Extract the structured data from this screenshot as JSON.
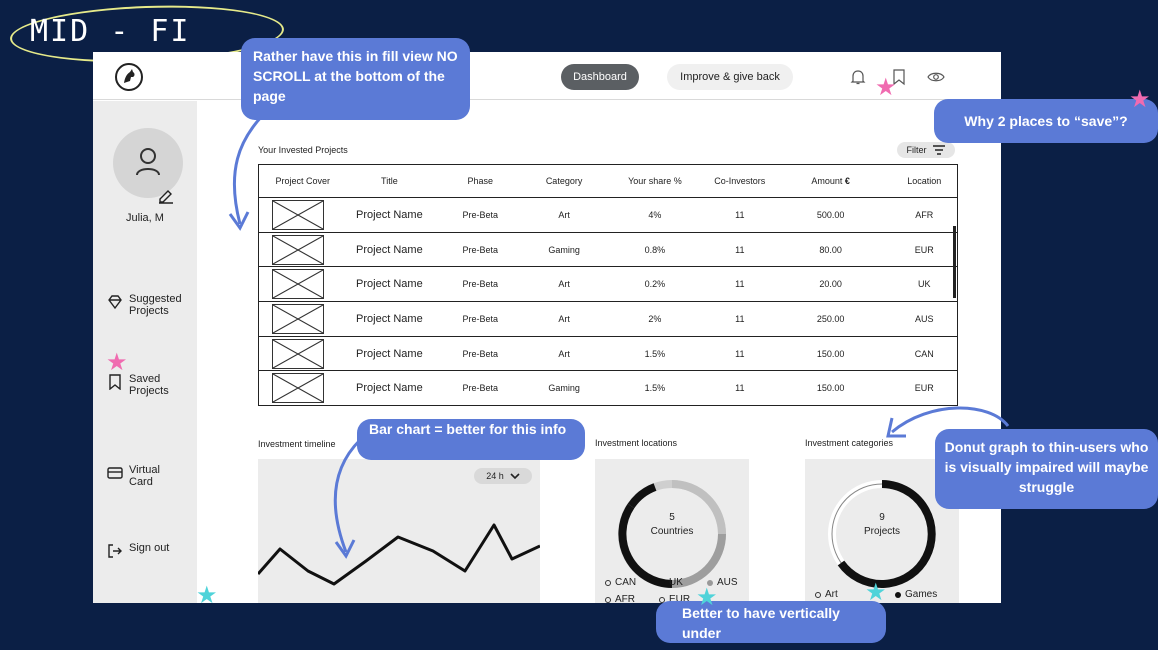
{
  "mockup_label": "MID - FI",
  "header": {
    "dashboard_label": "Dashboard",
    "improve_label": "Improve & give back"
  },
  "sidebar": {
    "user_name": "Julia, M",
    "items": [
      {
        "line1": "Suggested",
        "line2": "Projects",
        "icon": "diamond-icon"
      },
      {
        "line1": "Saved",
        "line2": "Projects",
        "icon": "bookmark-icon"
      },
      {
        "line1": "Virtual",
        "line2": "Card",
        "icon": "card-icon"
      },
      {
        "line1": "Sign out",
        "line2": "",
        "icon": "sign-out-icon"
      }
    ]
  },
  "projects": {
    "section_title": "Your Invested Projects",
    "filter_label": "Filter",
    "columns": [
      "Project Cover",
      "Title",
      "Phase",
      "Category",
      "Your share %",
      "Co-Investors",
      "Amount",
      "Location"
    ],
    "rows": [
      {
        "title": "Project Name",
        "phase": "Pre-Beta",
        "category": "Art",
        "share": "4%",
        "co": "11",
        "amount": "500.00",
        "location": "AFR"
      },
      {
        "title": "Project Name",
        "phase": "Pre-Beta",
        "category": "Gaming",
        "share": "0.8%",
        "co": "11",
        "amount": "80.00",
        "location": "EUR"
      },
      {
        "title": "Project Name",
        "phase": "Pre-Beta",
        "category": "Art",
        "share": "0.2%",
        "co": "11",
        "amount": "20.00",
        "location": "UK"
      },
      {
        "title": "Project Name",
        "phase": "Pre-Beta",
        "category": "Art",
        "share": "2%",
        "co": "11",
        "amount": "250.00",
        "location": "AUS"
      },
      {
        "title": "Project Name",
        "phase": "Pre-Beta",
        "category": "Art",
        "share": "1.5%",
        "co": "11",
        "amount": "150.00",
        "location": "CAN"
      },
      {
        "title": "Project Name",
        "phase": "Pre-Beta",
        "category": "Gaming",
        "share": "1.5%",
        "co": "11",
        "amount": "150.00",
        "location": "EUR"
      }
    ]
  },
  "timeline": {
    "title": "Investment timeline",
    "range_label": "24 h"
  },
  "locations": {
    "title": "Investment locations",
    "count": "5",
    "unit": "Countries",
    "legend": [
      "CAN",
      "UK",
      "AUS",
      "AFR",
      "EUR"
    ]
  },
  "categories": {
    "title": "Investment categories",
    "count": "9",
    "unit": "Projects",
    "legend": [
      "Art",
      "Games"
    ]
  },
  "annotations": {
    "scroll": "Rather have this in fill view NO SCROLL at the bottom of the page",
    "save": "Why 2 places to “save”?",
    "bar": "Bar chart = better for this info",
    "donut": "Donut graph to thin-users who is visually impaired will maybe struggle",
    "vertical": "Better to have vertically under"
  },
  "colors": {
    "background": "#0b1f45",
    "callout": "#5b7ad6",
    "star_pink": "#f06bb0",
    "star_cyan": "#4fd3d9"
  }
}
